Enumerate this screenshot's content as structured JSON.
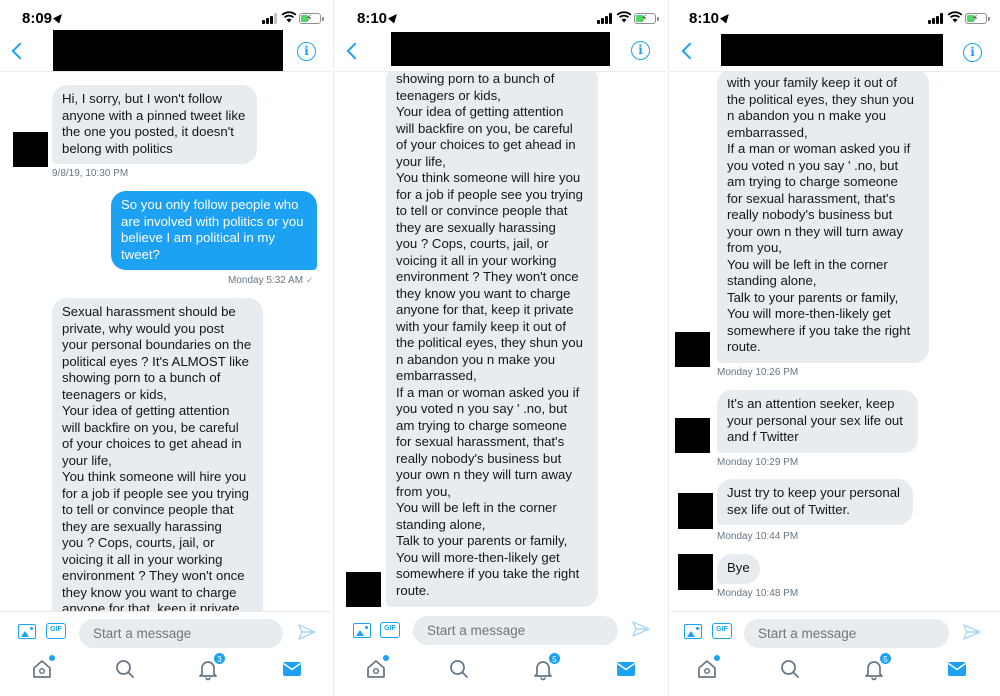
{
  "panels": [
    {
      "status_time": "8:09",
      "thread_timestamps": [
        "9/8/19, 10:30 PM",
        "Monday 5:32 AM"
      ],
      "messages": [
        {
          "dir": "in",
          "lines": [
            "Hi, I sorry, but I won't follow",
            "anyone with a pinned tweet like",
            "the one you posted, it doesn't",
            "belong with politics"
          ]
        },
        {
          "dir": "out",
          "lines": [
            "So you only follow people who",
            "are involved with politics or you",
            "believe I am political in my",
            "tweet?"
          ]
        },
        {
          "dir": "in",
          "lines": [
            "Sexual harassment should  be",
            "private, why would you post",
            "your personal boundaries on the",
            "political eyes ?  It's ALMOST like",
            "showing porn to a bunch of",
            "teenagers or kids,",
            "Your idea of getting attention",
            "will backfire on you, be careful",
            "of your choices to get ahead in",
            "your life,",
            "You think someone will hire you",
            "for a job if people see you trying",
            "to tell or convince people that",
            "they are sexually harassing",
            "you ?  Cops, courts, jail,  or",
            "voicing it all in your working",
            "environment ?  They won't once",
            "they know you want to charge",
            "anyone for that, keep it private"
          ]
        }
      ],
      "notification_badge": "3"
    },
    {
      "status_time": "8:10",
      "messages": [
        {
          "dir": "in",
          "lines": [
            "showing porn to a bunch of",
            "teenagers or kids,",
            "Your idea of getting attention",
            "will backfire on you, be careful",
            "of your choices to get ahead in",
            "your life,",
            "You think someone will hire you",
            "for a job if people see you trying",
            "to tell or convince people that",
            "they are sexually harassing",
            "you ?  Cops, courts, jail,  or",
            "voicing it all in your working",
            "environment ?  They won't once",
            "they know you want to charge",
            "anyone for that, keep it private",
            "with your family keep it out of",
            "the political eyes, they shun you",
            "n abandon you n make you",
            "embarrassed,",
            "If a man or woman asked you if",
            "you voted n you say ' .no,  but",
            "am trying to charge someone",
            "for sexual harassment, that's",
            "really nobody's business but",
            "your own n they will turn away",
            "from you,",
            "You will be left in the corner",
            "standing alone,",
            "Talk to your parents or family,",
            "You will more-then-likely get",
            "somewhere if you take the right",
            "route."
          ]
        }
      ],
      "notification_badge": "5"
    },
    {
      "status_time": "8:10",
      "messages": [
        {
          "dir": "in",
          "lines": [
            "with your family keep it out of",
            "the political eyes, they shun you",
            "n abandon you n make you",
            "embarrassed,",
            "If a man or woman asked you if",
            "you voted n you say ' .no,  but",
            "am trying to charge someone",
            "for sexual harassment, that's",
            "really nobody's business but",
            "your own n they will turn away",
            "from you,",
            "You will be left in the corner",
            "standing alone,",
            "Talk to your parents or family,",
            "You will more-then-likely get",
            "somewhere if you take the right",
            "route."
          ],
          "time": "Monday 10:26 PM"
        },
        {
          "dir": "in",
          "lines": [
            "It's an attention seeker, keep",
            "your personal  your sex life out",
            "and f Twitter"
          ],
          "time": "Monday 10:29 PM"
        },
        {
          "dir": "in",
          "lines": [
            "Just try to keep your personal",
            "sex life out of Twitter."
          ],
          "time": "Monday 10:44 PM"
        },
        {
          "dir": "in",
          "lines": [
            "Bye"
          ],
          "time": "Monday 10:48 PM"
        }
      ],
      "notification_badge": "5"
    }
  ],
  "composer": {
    "placeholder": "Start a message",
    "gif_label": "GIF"
  },
  "icons": {
    "back": "chevron-left-icon",
    "info": "info-icon",
    "media": "image-icon",
    "gif": "gif-icon",
    "send": "send-icon",
    "home": "home-icon",
    "search": "search-icon",
    "notifications": "bell-icon",
    "messages": "mail-icon"
  },
  "info_glyph": "i",
  "colors": {
    "accent": "#1da1f2",
    "incoming_bubble": "#e6ecf0",
    "timestamp": "#657786"
  }
}
